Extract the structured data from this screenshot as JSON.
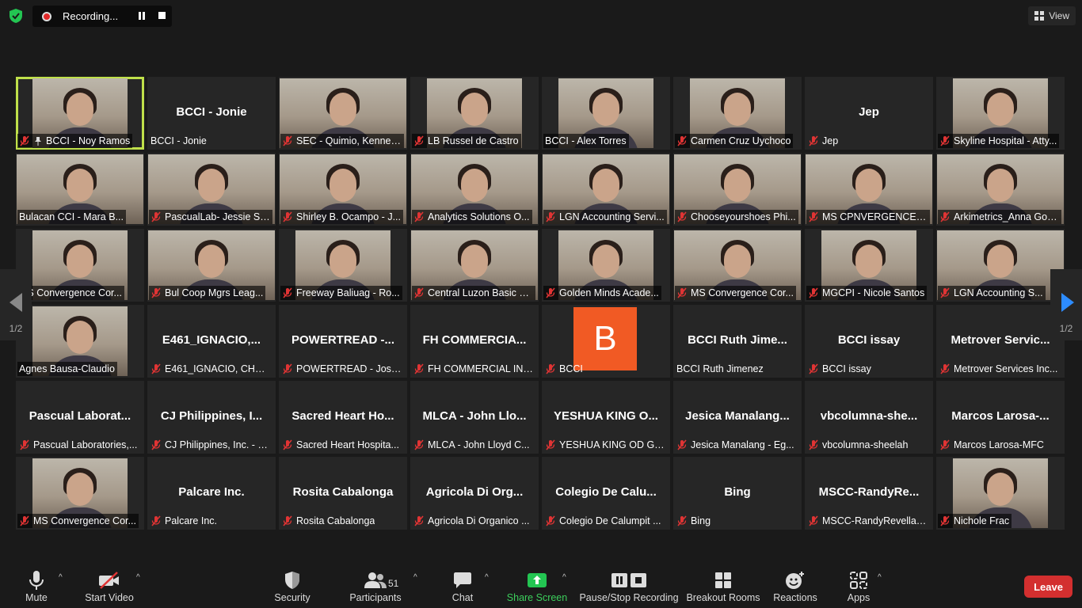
{
  "topbar": {
    "recording_label": "Recording...",
    "view_label": "View"
  },
  "colors": {
    "active_border": "#bfe04a",
    "muted_red": "#e03434",
    "share_green": "#23c552",
    "leave_red": "#d32f2f",
    "avatar_orange": "#f15a24",
    "nav_blue": "#2d8cff"
  },
  "pages": {
    "left": "1/2",
    "right": "1/2"
  },
  "tiles": [
    {
      "name": "BCCI - Noy Ramos",
      "big": "",
      "video": true,
      "muted": true,
      "active": true,
      "pinned": true
    },
    {
      "name": "BCCI - Jonie",
      "big": "BCCI - Jonie",
      "video": false,
      "muted": false
    },
    {
      "name": "SEC - Quimio, Kennet...",
      "big": "",
      "video": true,
      "muted": true,
      "wide": true
    },
    {
      "name": "LB Russel de Castro",
      "big": "",
      "video": true,
      "muted": true
    },
    {
      "name": "BCCI - Alex Torres",
      "big": "",
      "video": true,
      "muted": false
    },
    {
      "name": "Carmen Cruz Uychoco",
      "big": "",
      "video": true,
      "muted": true
    },
    {
      "name": "Jep",
      "big": "Jep",
      "video": false,
      "muted": true
    },
    {
      "name": "Skyline Hospital - Atty...",
      "big": "",
      "video": true,
      "muted": true
    },
    {
      "name": "Bulacan CCI - Mara B...",
      "big": "",
      "video": true,
      "muted": false,
      "wide": true
    },
    {
      "name": "PascualLab- Jessie Sa...",
      "big": "",
      "video": true,
      "muted": true,
      "wide": true
    },
    {
      "name": "Shirley B. Ocampo - J...",
      "big": "",
      "video": true,
      "muted": true,
      "wide": true
    },
    {
      "name": "Analytics Solutions O...",
      "big": "",
      "video": true,
      "muted": true,
      "wide": true
    },
    {
      "name": "LGN Accounting Servi...",
      "big": "",
      "video": true,
      "muted": true,
      "wide": true
    },
    {
      "name": "Chooseyourshoes Phi...",
      "big": "",
      "video": true,
      "muted": true,
      "wide": true
    },
    {
      "name": "MS CPNVERGENCE C...",
      "big": "",
      "video": true,
      "muted": true,
      "wide": true
    },
    {
      "name": "Arkimetrics_Anna Gon...",
      "big": "",
      "video": true,
      "muted": true,
      "wide": true
    },
    {
      "name": "MS Convergence Cor...",
      "big": "",
      "video": true,
      "muted": false
    },
    {
      "name": "Bul Coop Mgrs Leag...",
      "big": "",
      "video": true,
      "muted": true,
      "wide": true
    },
    {
      "name": "Freeway Baliuag - Ro...",
      "big": "",
      "video": true,
      "muted": true
    },
    {
      "name": "Central Luzon Basic H...",
      "big": "",
      "video": true,
      "muted": true,
      "wide": true
    },
    {
      "name": "Golden Minds Acade...",
      "big": "",
      "video": true,
      "muted": true
    },
    {
      "name": "MS Convergence Cor...",
      "big": "",
      "video": true,
      "muted": true,
      "wide": true
    },
    {
      "name": "MGCPI - Nicole Santos",
      "big": "",
      "video": true,
      "muted": true
    },
    {
      "name": "LGN Accounting S...",
      "big": "",
      "video": true,
      "muted": true,
      "wide": true
    },
    {
      "name": "Agnes Bausa-Claudio",
      "big": "",
      "video": true,
      "muted": false
    },
    {
      "name": "E461_IGNACIO, CHER...",
      "big": "E461_IGNACIO,...",
      "video": false,
      "muted": true
    },
    {
      "name": "POWERTREAD - Josie...",
      "big": "POWERTREAD -...",
      "video": false,
      "muted": true
    },
    {
      "name": "FH COMMERCIAL INC...",
      "big": "FH COMMERCIA...",
      "video": false,
      "muted": true
    },
    {
      "name": "BCCI",
      "big": "",
      "video": false,
      "muted": true,
      "avatar": "B"
    },
    {
      "name": "BCCI Ruth Jimenez",
      "big": "BCCI Ruth Jime...",
      "video": false,
      "muted": false
    },
    {
      "name": "BCCI issay",
      "big": "BCCI issay",
      "video": false,
      "muted": true
    },
    {
      "name": "Metrover Services Inc...",
      "big": "Metrover Servic...",
      "video": false,
      "muted": true
    },
    {
      "name": "Pascual Laboratories,...",
      "big": "Pascual Laborat...",
      "video": false,
      "muted": true
    },
    {
      "name": "CJ Philippines, Inc. - R...",
      "big": "CJ Philippines, I...",
      "video": false,
      "muted": true
    },
    {
      "name": "Sacred Heart Hospita...",
      "big": "Sacred Heart Ho...",
      "video": false,
      "muted": true
    },
    {
      "name": "MLCA - John Lloyd C...",
      "big": "MLCA - John Llo...",
      "video": false,
      "muted": true
    },
    {
      "name": "YESHUA KING OD GL...",
      "big": "YESHUA KING O...",
      "video": false,
      "muted": true
    },
    {
      "name": "Jesica Manalang - Eg...",
      "big": "Jesica Manalang...",
      "video": false,
      "muted": true
    },
    {
      "name": "vbcolumna-sheelah",
      "big": "vbcolumna-she...",
      "video": false,
      "muted": true
    },
    {
      "name": "Marcos Larosa-MFC",
      "big": "Marcos Larosa-...",
      "video": false,
      "muted": true
    },
    {
      "name": "MS Convergence Cor...",
      "big": "",
      "video": true,
      "muted": true
    },
    {
      "name": "Palcare Inc.",
      "big": "Palcare Inc.",
      "video": false,
      "muted": true
    },
    {
      "name": "Rosita Cabalonga",
      "big": "Rosita Cabalonga",
      "video": false,
      "muted": true
    },
    {
      "name": "Agricola Di Organico ...",
      "big": "Agricola Di Org...",
      "video": false,
      "muted": true
    },
    {
      "name": "Colegio De Calumpit ...",
      "big": "Colegio De Calu...",
      "video": false,
      "muted": true
    },
    {
      "name": "Bing",
      "big": "Bing",
      "video": false,
      "muted": true
    },
    {
      "name": "MSCC-RandyRevellame",
      "big": "MSCC-RandyRe...",
      "video": false,
      "muted": true
    },
    {
      "name": "Nichole Frac",
      "big": "",
      "video": true,
      "muted": true
    }
  ],
  "toolbar": {
    "mute": "Mute",
    "start_video": "Start Video",
    "security": "Security",
    "participants": "Participants",
    "participants_count": "51",
    "chat": "Chat",
    "share_screen": "Share Screen",
    "pause_stop": "Pause/Stop Recording",
    "breakout": "Breakout Rooms",
    "reactions": "Reactions",
    "apps": "Apps",
    "leave": "Leave"
  }
}
